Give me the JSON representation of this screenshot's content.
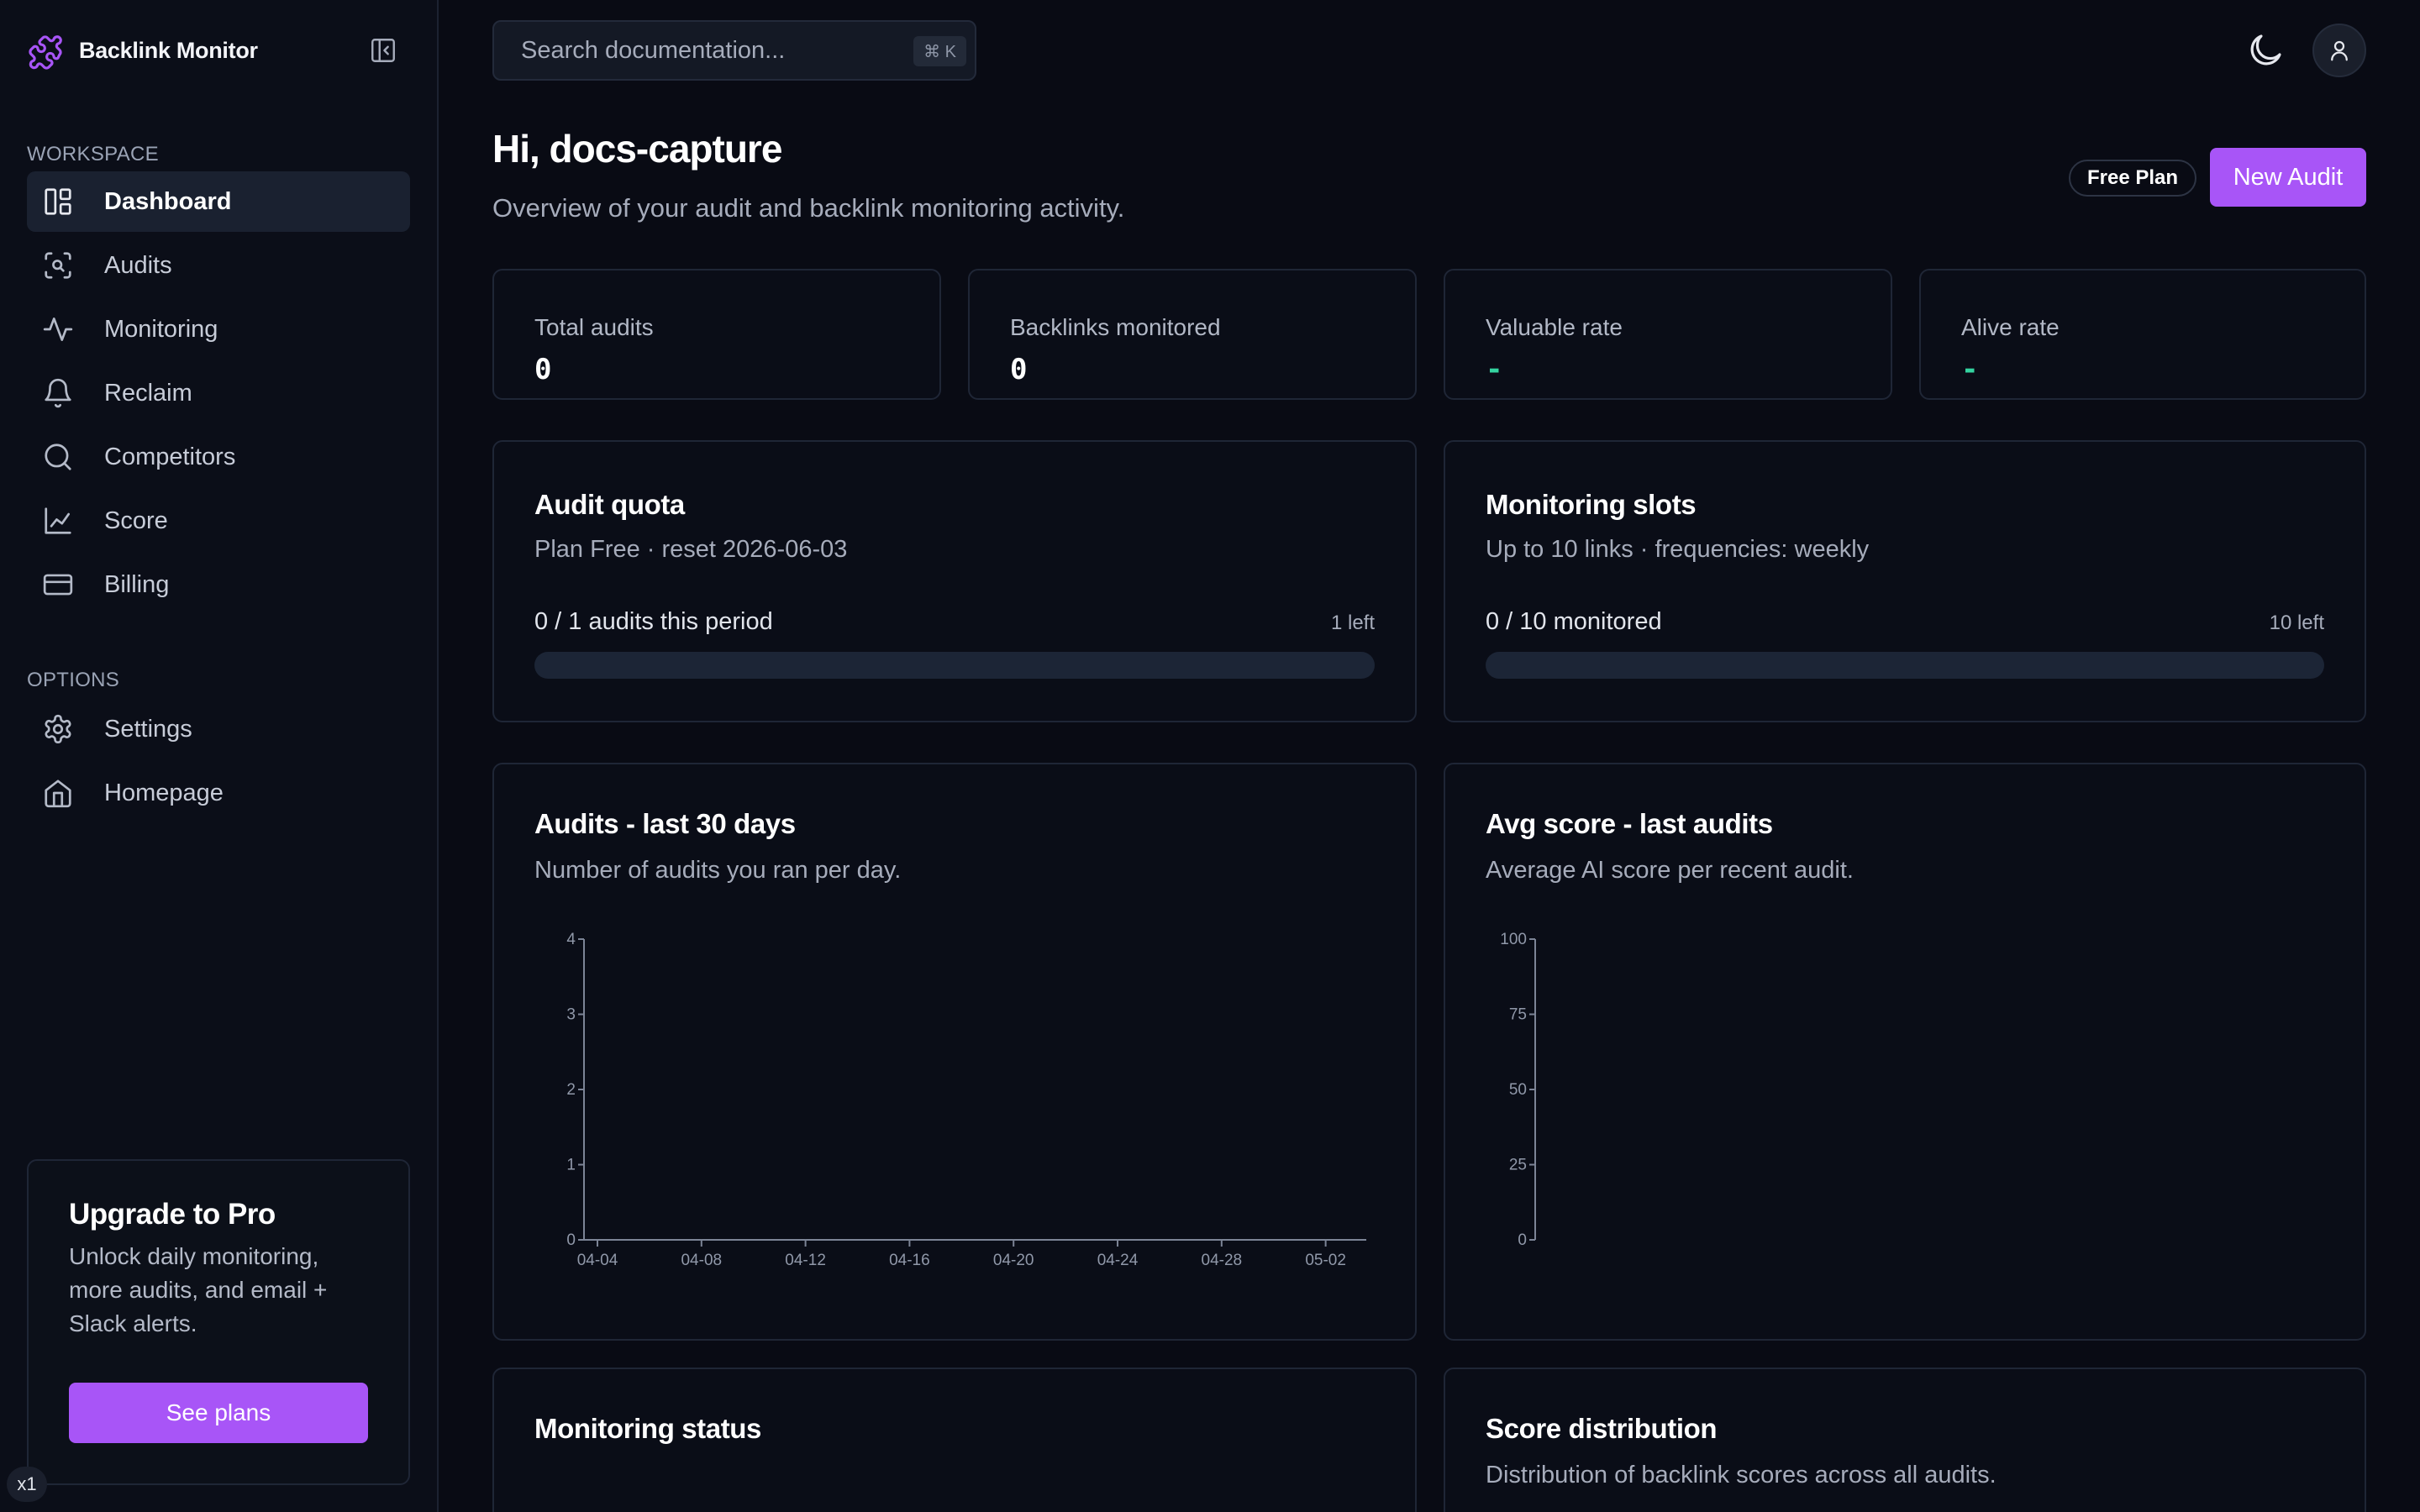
{
  "app": {
    "name": "Backlink Monitor"
  },
  "sidebar": {
    "workspace_label": "WORKSPACE",
    "workspace_items": [
      {
        "label": "Dashboard",
        "icon": "dashboard-icon",
        "active": true
      },
      {
        "label": "Audits",
        "icon": "scan-icon"
      },
      {
        "label": "Monitoring",
        "icon": "activity-icon"
      },
      {
        "label": "Reclaim",
        "icon": "bell-icon"
      },
      {
        "label": "Competitors",
        "icon": "search-icon"
      },
      {
        "label": "Score",
        "icon": "line-chart-icon"
      },
      {
        "label": "Billing",
        "icon": "credit-card-icon"
      }
    ],
    "options_label": "OPTIONS",
    "options_items": [
      {
        "label": "Settings",
        "icon": "gear-icon"
      },
      {
        "label": "Homepage",
        "icon": "home-icon"
      }
    ],
    "upgrade": {
      "title": "Upgrade to Pro",
      "text": "Unlock daily monitoring, more audits, and email + Slack alerts.",
      "button": "See plans"
    },
    "zoom_badge": "x1"
  },
  "topbar": {
    "search_placeholder": "Search documentation...",
    "shortcut": "⌘ K"
  },
  "header": {
    "greeting": "Hi, docs-capture",
    "subtitle": "Overview of your audit and backlink monitoring activity.",
    "plan_badge": "Free Plan",
    "new_audit": "New Audit"
  },
  "stats": [
    {
      "label": "Total audits",
      "value": "0"
    },
    {
      "label": "Backlinks monitored",
      "value": "0"
    },
    {
      "label": "Valuable rate",
      "value": "-"
    },
    {
      "label": "Alive rate",
      "value": "-"
    }
  ],
  "audit_quota": {
    "title": "Audit quota",
    "subtitle": "Plan Free · reset 2026-06-03",
    "progress_label": "0 / 1 audits this period",
    "remaining": "1 left",
    "fraction": 0
  },
  "monitoring_slots": {
    "title": "Monitoring slots",
    "subtitle": "Up to 10 links · frequencies: weekly",
    "progress_label": "0 / 10 monitored",
    "remaining": "10 left",
    "fraction": 0
  },
  "audits_chart": {
    "title": "Audits - last 30 days",
    "subtitle": "Number of audits you ran per day."
  },
  "score_chart": {
    "title": "Avg score - last audits",
    "subtitle": "Average AI score per recent audit."
  },
  "monitoring_status": {
    "title": "Monitoring status"
  },
  "score_distribution": {
    "title": "Score distribution",
    "subtitle": "Distribution of backlink scores across all audits."
  },
  "chart_data": [
    {
      "type": "bar",
      "categories": [
        "04-04",
        "04-08",
        "04-12",
        "04-16",
        "04-20",
        "04-24",
        "04-28",
        "05-02"
      ],
      "values": [],
      "yticks": [
        0,
        1,
        2,
        3,
        4
      ],
      "ylim": [
        0,
        4
      ],
      "grid": false
    },
    {
      "type": "bar",
      "categories": [],
      "values": [],
      "yticks": [
        0,
        25,
        50,
        75,
        100
      ],
      "ylim": [
        0,
        100
      ],
      "grid": false
    }
  ]
}
